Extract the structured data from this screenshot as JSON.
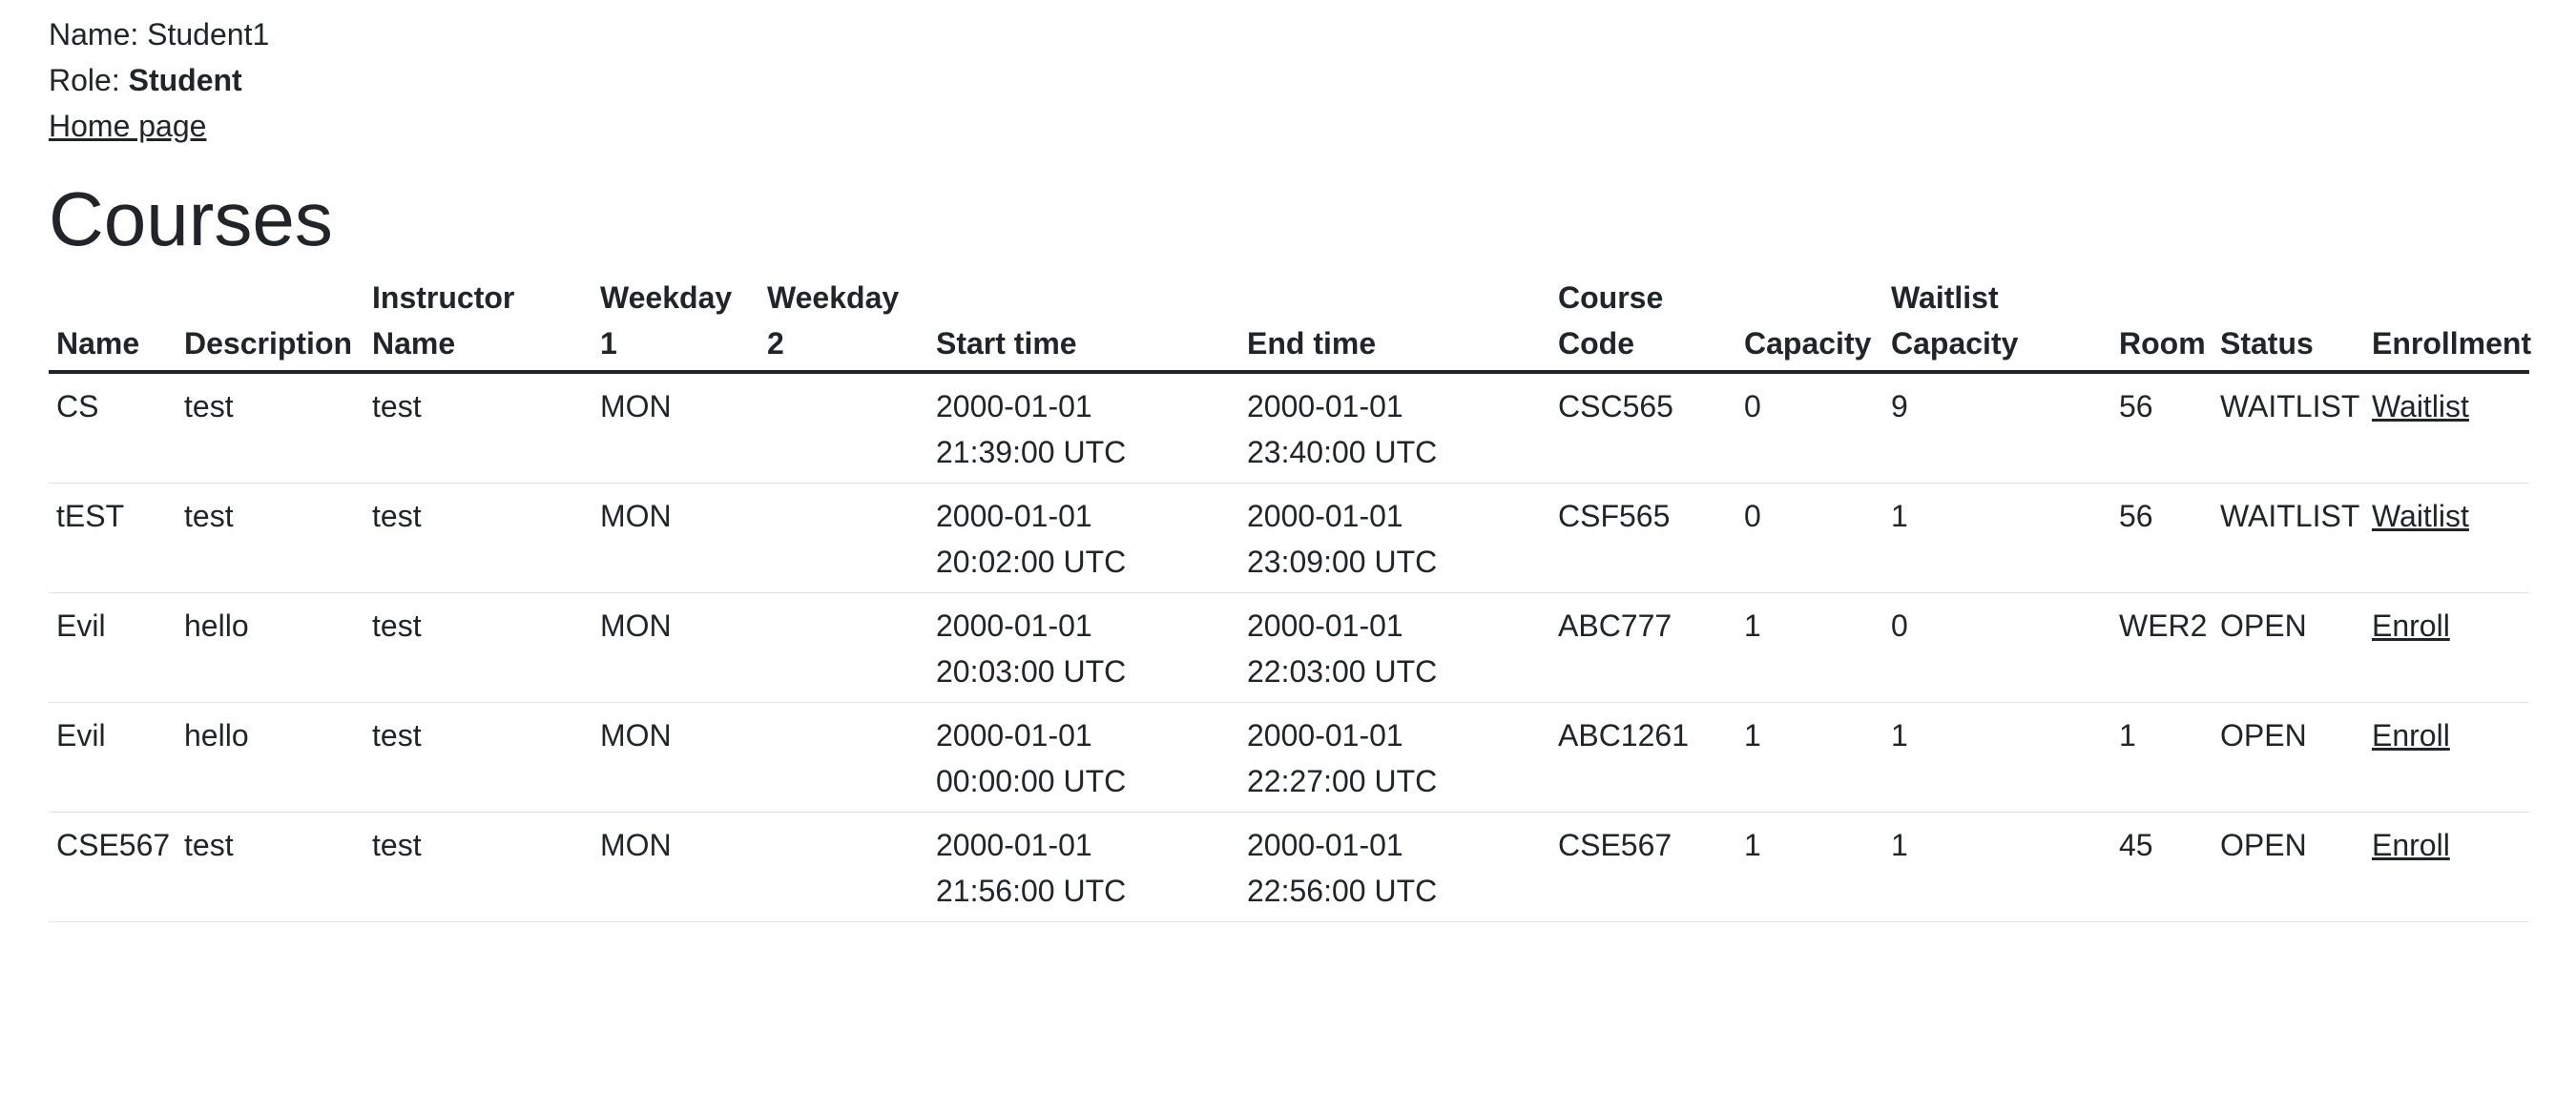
{
  "user": {
    "name_label": "Name: Student1",
    "role_label": "Role: ",
    "role_value": "Student",
    "home_link": "Home page"
  },
  "page_title": "Courses",
  "table": {
    "headers": [
      "Name",
      "Description",
      "Instructor Name",
      "Weekday 1",
      "Weekday 2",
      "Start time",
      "End time",
      "Course Code",
      "Capacity",
      "Waitlist Capacity",
      "Room",
      "Status",
      "Enrollment"
    ],
    "rows": [
      {
        "name": "CS",
        "description": "test",
        "instructor": "test",
        "weekday1": "MON",
        "weekday2": "",
        "start_date": "2000-01-01",
        "start_time": "21:39:00 UTC",
        "end_date": "2000-01-01",
        "end_time": "23:40:00 UTC",
        "code": "CSC565",
        "capacity": "0",
        "waitlist_capacity": "9",
        "room": "56",
        "status": "WAITLIST",
        "action": "Waitlist"
      },
      {
        "name": "tEST",
        "description": "test",
        "instructor": "test",
        "weekday1": "MON",
        "weekday2": "",
        "start_date": "2000-01-01",
        "start_time": "20:02:00 UTC",
        "end_date": "2000-01-01",
        "end_time": "23:09:00 UTC",
        "code": "CSF565",
        "capacity": "0",
        "waitlist_capacity": "1",
        "room": "56",
        "status": "WAITLIST",
        "action": "Waitlist"
      },
      {
        "name": "Evil",
        "description": "hello",
        "instructor": "test",
        "weekday1": "MON",
        "weekday2": "",
        "start_date": "2000-01-01",
        "start_time": "20:03:00 UTC",
        "end_date": "2000-01-01",
        "end_time": "22:03:00 UTC",
        "code": "ABC777",
        "capacity": "1",
        "waitlist_capacity": "0",
        "room": "WER2",
        "status": "OPEN",
        "action": "Enroll"
      },
      {
        "name": "Evil",
        "description": "hello",
        "instructor": "test",
        "weekday1": "MON",
        "weekday2": "",
        "start_date": "2000-01-01",
        "start_time": "00:00:00 UTC",
        "end_date": "2000-01-01",
        "end_time": "22:27:00 UTC",
        "code": "ABC1261",
        "capacity": "1",
        "waitlist_capacity": "1",
        "room": "1",
        "status": "OPEN",
        "action": "Enroll"
      },
      {
        "name": "CSE567",
        "description": "test",
        "instructor": "test",
        "weekday1": "MON",
        "weekday2": "",
        "start_date": "2000-01-01",
        "start_time": "21:56:00 UTC",
        "end_date": "2000-01-01",
        "end_time": "22:56:00 UTC",
        "code": "CSE567",
        "capacity": "1",
        "waitlist_capacity": "1",
        "room": "45",
        "status": "OPEN",
        "action": "Enroll"
      }
    ]
  }
}
